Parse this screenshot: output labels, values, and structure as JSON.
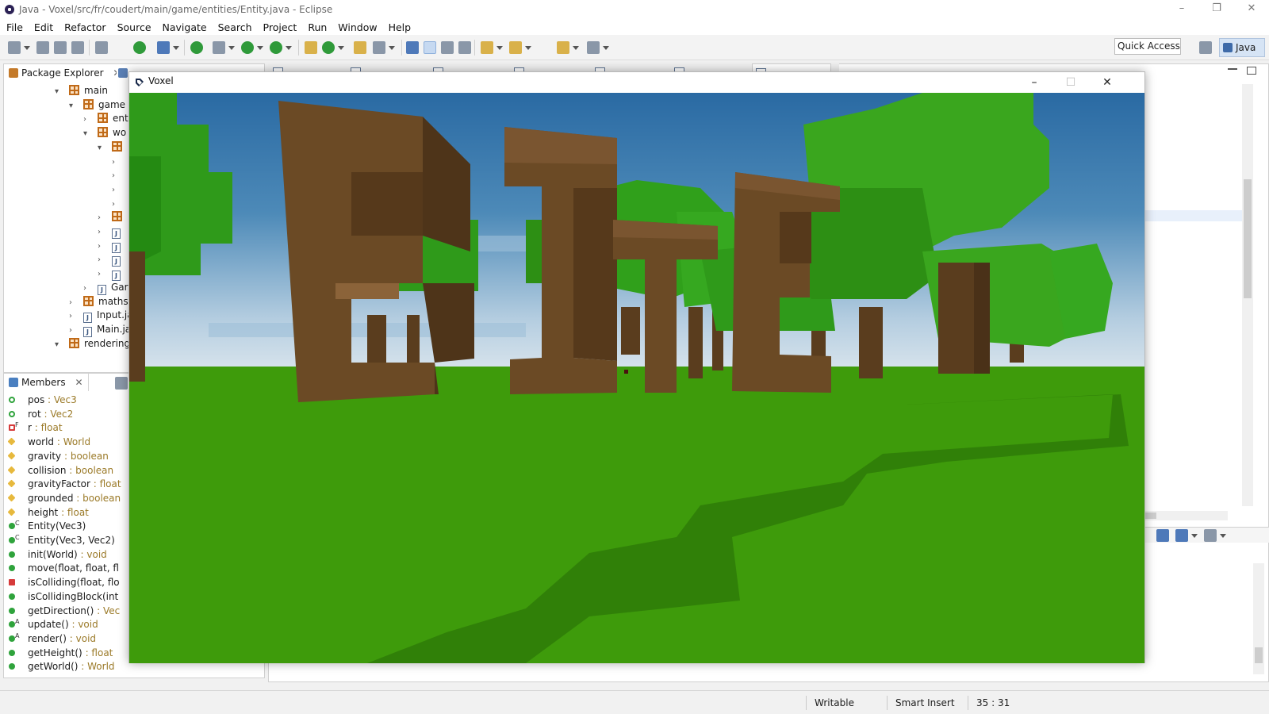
{
  "titlebar": {
    "title": "Java - Voxel/src/fr/coudert/main/game/entities/Entity.java - Eclipse",
    "minimize": "–",
    "restore": "❐",
    "close": "✕"
  },
  "menu": [
    "File",
    "Edit",
    "Refactor",
    "Source",
    "Navigate",
    "Search",
    "Project",
    "Run",
    "Window",
    "Help"
  ],
  "toolbar": {
    "quick_access": "Quick Access",
    "perspective": "Java"
  },
  "package_explorer": {
    "tab_label": "Package Explorer",
    "tree": [
      {
        "label": "main",
        "kind": "package"
      },
      {
        "label": "game",
        "kind": "package"
      },
      {
        "label": "ent",
        "kind": "package"
      },
      {
        "label": "wo",
        "kind": "package"
      },
      {
        "label": "",
        "kind": "package"
      },
      {
        "label": "",
        "kind": "collapsed"
      },
      {
        "label": "",
        "kind": "collapsed"
      },
      {
        "label": "",
        "kind": "collapsed"
      },
      {
        "label": "",
        "kind": "collapsed"
      },
      {
        "label": "",
        "kind": "package"
      },
      {
        "label": "",
        "kind": "file"
      },
      {
        "label": "",
        "kind": "file"
      },
      {
        "label": "",
        "kind": "file"
      },
      {
        "label": "",
        "kind": "file"
      },
      {
        "label": "Gar",
        "kind": "file"
      },
      {
        "label": "maths",
        "kind": "package"
      },
      {
        "label": "Input.ja",
        "kind": "file"
      },
      {
        "label": "Main.ja",
        "kind": "file"
      },
      {
        "label": "rendering",
        "kind": "package"
      }
    ]
  },
  "members": {
    "tab_label": "Members",
    "items": [
      {
        "name": "pos",
        "type": " : Vec3",
        "vis": "pubring"
      },
      {
        "name": "rot",
        "type": " : Vec2",
        "vis": "pubring"
      },
      {
        "name": "r",
        "type": " : float",
        "vis": "privring",
        "mod": "F"
      },
      {
        "name": "world",
        "type": " : World",
        "vis": "prot"
      },
      {
        "name": "gravity",
        "type": " : boolean",
        "vis": "prot"
      },
      {
        "name": "collision",
        "type": " : boolean",
        "vis": "prot"
      },
      {
        "name": "gravityFactor",
        "type": " : float",
        "vis": "prot"
      },
      {
        "name": "grounded",
        "type": " : boolean",
        "vis": "prot"
      },
      {
        "name": "height",
        "type": " : float",
        "vis": "prot"
      },
      {
        "name": "Entity(Vec3)",
        "type": "",
        "vis": "pub",
        "mod": "C"
      },
      {
        "name": "Entity(Vec3, Vec2)",
        "type": "",
        "vis": "pub",
        "mod": "C"
      },
      {
        "name": "init(World)",
        "type": " : void",
        "vis": "pub"
      },
      {
        "name": "move(float, float, fl",
        "type": "",
        "vis": "pub"
      },
      {
        "name": "isColliding(float, flo",
        "type": "",
        "vis": "priv"
      },
      {
        "name": "isCollidingBlock(int",
        "type": "",
        "vis": "pub"
      },
      {
        "name": "getDirection()",
        "type": " : Vec",
        "vis": "pub"
      },
      {
        "name": "update()",
        "type": " : void",
        "vis": "pub",
        "mod": "A"
      },
      {
        "name": "render()",
        "type": " : void",
        "vis": "pub",
        "mod": "A"
      },
      {
        "name": "getHeight()",
        "type": " : float",
        "vis": "pub"
      },
      {
        "name": "getWorld()",
        "type": " : World",
        "vis": "pub"
      }
    ]
  },
  "voxel_window": {
    "title": "Voxel"
  },
  "status": {
    "writable": "Writable",
    "insert_mode": "Smart Insert",
    "position": "35 : 31"
  }
}
